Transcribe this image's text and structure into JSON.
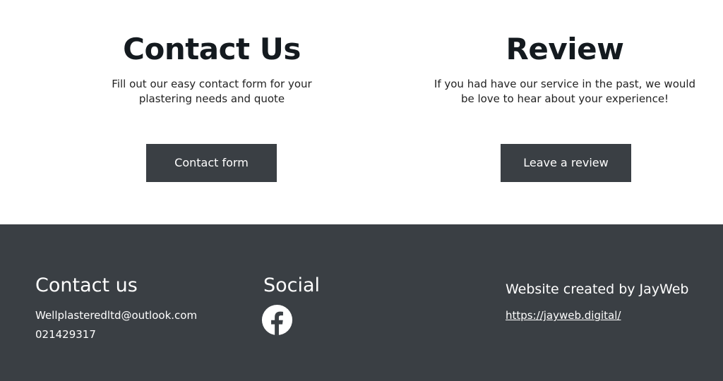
{
  "contact_section": {
    "title": "Contact Us",
    "description": "Fill out our easy contact form for your plastering needs and quote",
    "button_label": "Contact form"
  },
  "review_section": {
    "title": "Review",
    "description": "If you had have our service in the past, we would be love to hear about your experience!",
    "button_label": "Leave a review"
  },
  "footer": {
    "contact": {
      "heading": "Contact us",
      "email": "Wellplasteredltd@outlook.com",
      "phone": "021429317"
    },
    "social": {
      "heading": "Social",
      "icons": [
        "facebook-icon"
      ]
    },
    "credit": {
      "heading": "Website created by JayWeb",
      "link_text": "https://jayweb.digital/"
    }
  },
  "colors": {
    "button_bg": "#3a3f44",
    "footer_bg": "#3a3f44",
    "heading_text": "#141a1f"
  }
}
